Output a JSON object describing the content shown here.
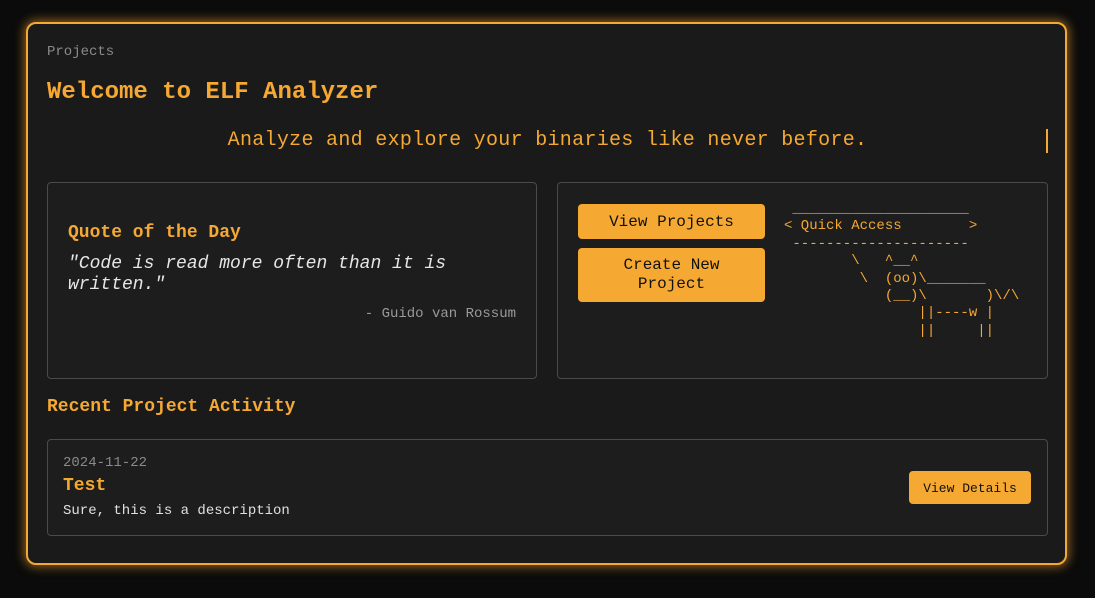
{
  "breadcrumb": "Projects",
  "title": "Welcome to ELF Analyzer",
  "tagline": "Analyze and explore your binaries like never before.",
  "quote": {
    "heading": "Quote of the Day",
    "text": "\"Code is read more often than it is written.\"",
    "author": "- Guido van Rossum"
  },
  "quick_access": {
    "view_projects_label": "View Projects",
    "create_project_label": "Create New Project",
    "ascii_art": " _____________________\n< Quick Access        >\n ---------------------\n        \\   ^__^\n         \\  (oo)\\_______\n            (__)\\       )\\/\\\n                ||----w |\n                ||     ||"
  },
  "recent": {
    "heading": "Recent Project Activity",
    "items": [
      {
        "date": "2024-11-22",
        "name": "Test",
        "description": "Sure, this is a description",
        "button_label": "View Details"
      }
    ]
  },
  "colors": {
    "accent": "#f5a832",
    "background": "#1a1a1a",
    "page_background": "#0b0b0b"
  }
}
